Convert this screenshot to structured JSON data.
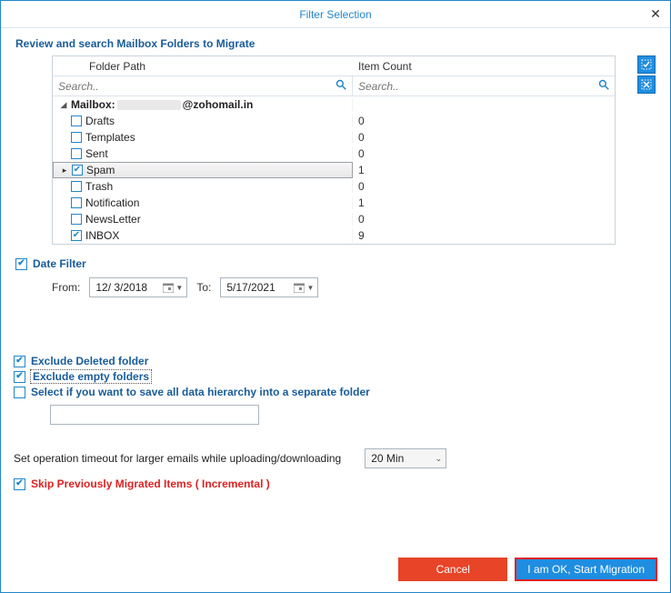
{
  "title": "Filter Selection",
  "header": "Review and search Mailbox Folders to Migrate",
  "columns": {
    "folder": "Folder Path",
    "count": "Item Count"
  },
  "search_placeholder": "Search..",
  "mailbox": {
    "label": "Mailbox:",
    "domain": "@zohomail.in"
  },
  "folders": [
    {
      "name": "Drafts",
      "count": "0",
      "checked": false
    },
    {
      "name": "Templates",
      "count": "0",
      "checked": false
    },
    {
      "name": "Sent",
      "count": "0",
      "checked": false
    },
    {
      "name": "Spam",
      "count": "1",
      "checked": true,
      "selected": true
    },
    {
      "name": "Trash",
      "count": "0",
      "checked": false
    },
    {
      "name": "Notification",
      "count": "1",
      "checked": false
    },
    {
      "name": "NewsLetter",
      "count": "0",
      "checked": false
    },
    {
      "name": "INBOX",
      "count": "9",
      "checked": true
    }
  ],
  "date_filter": {
    "label": "Date Filter",
    "checked": true,
    "from_label": "From:",
    "from_value": "12/  3/2018",
    "to_label": "To:",
    "to_value": "5/17/2021"
  },
  "options": {
    "exclude_deleted": {
      "label": "Exclude Deleted folder",
      "checked": true
    },
    "exclude_empty": {
      "label": "Exclude empty folders",
      "checked": true
    },
    "save_hierarchy": {
      "label": "Select if you want to save all data hierarchy into a separate folder",
      "checked": false
    }
  },
  "timeout": {
    "label": "Set operation timeout for larger emails while uploading/downloading",
    "value": "20 Min"
  },
  "skip": {
    "label": "Skip Previously Migrated Items ( Incremental )",
    "checked": true
  },
  "buttons": {
    "cancel": "Cancel",
    "ok": "I am OK, Start Migration"
  }
}
